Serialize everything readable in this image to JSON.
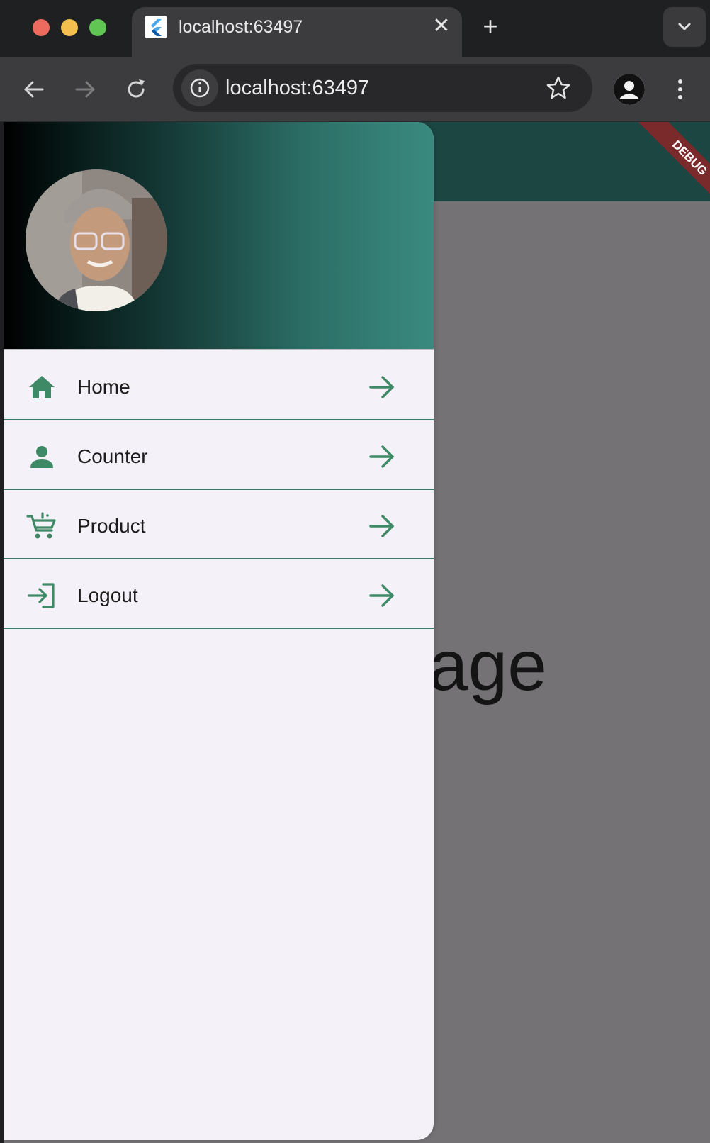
{
  "browser": {
    "tab_title": "localhost:63497",
    "address": "localhost:63497"
  },
  "app": {
    "page_text": "age",
    "debug_label": "DEBUG",
    "appbar_color": "#1b4642",
    "accent_color": "#3f8a66"
  },
  "drawer": {
    "items": [
      {
        "label": "Home",
        "icon": "home-icon"
      },
      {
        "label": "Counter",
        "icon": "person-icon"
      },
      {
        "label": "Product",
        "icon": "cart-icon"
      },
      {
        "label": "Logout",
        "icon": "login-icon"
      }
    ]
  }
}
